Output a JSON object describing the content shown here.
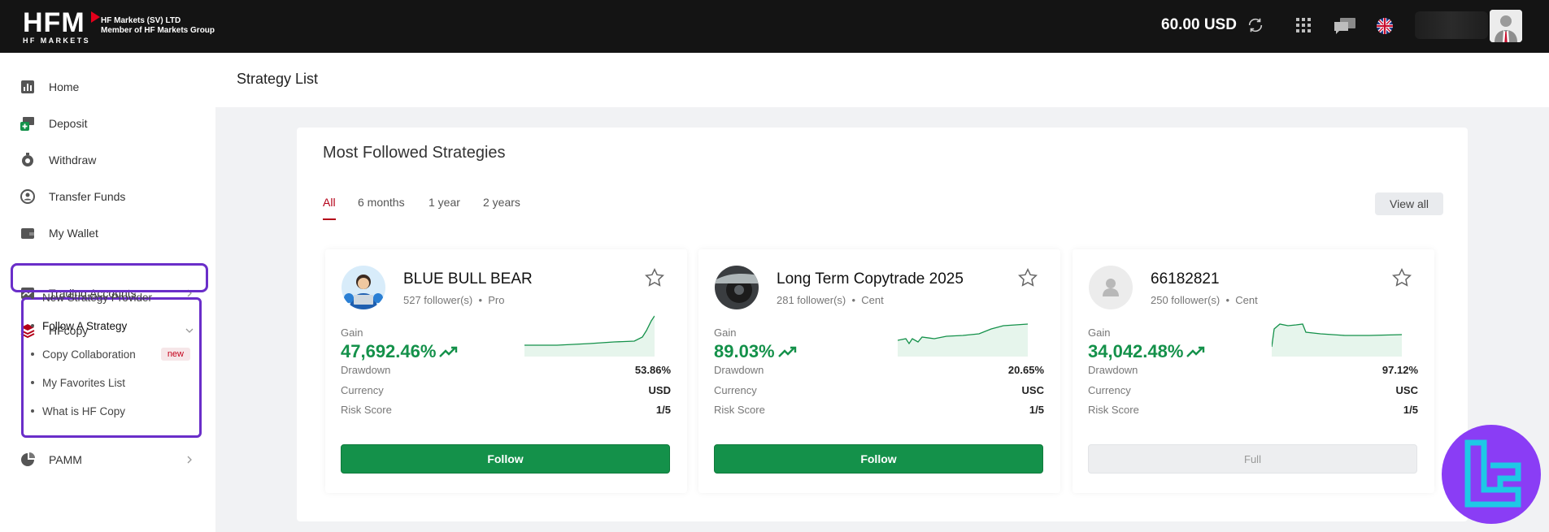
{
  "topbar": {
    "logo_big": "HFM",
    "logo_small": "HF MARKETS",
    "company_line1": "HF Markets (SV) LTD",
    "company_line2": "Member of HF Markets Group",
    "balance": "60.00 USD"
  },
  "sidebar": {
    "items": [
      {
        "label": "Home",
        "icon": "chart-icon"
      },
      {
        "label": "Deposit",
        "icon": "deposit-icon"
      },
      {
        "label": "Withdraw",
        "icon": "withdraw-icon"
      },
      {
        "label": "Transfer Funds",
        "icon": "transfer-icon"
      },
      {
        "label": "My Wallet",
        "icon": "wallet-icon"
      },
      {
        "label": "Trading Accounts",
        "icon": "trading-icon"
      },
      {
        "label": "HFcopy",
        "icon": "layers-icon"
      },
      {
        "label": "PAMM",
        "icon": "pie-icon"
      }
    ],
    "hfcopy_sub": [
      {
        "label": "New Strategy Provider"
      },
      {
        "label": "Follow A Strategy"
      },
      {
        "label": "Copy Collaboration",
        "badge": "new"
      },
      {
        "label": "My Favorites List"
      },
      {
        "label": "What is HF Copy"
      }
    ]
  },
  "header": {
    "title": "Strategy List"
  },
  "panel": {
    "title": "Most Followed Strategies",
    "tabs": [
      "All",
      "6 months",
      "1 year",
      "2 years"
    ],
    "view_all": "View all",
    "labels": {
      "gain": "Gain",
      "drawdown": "Drawdown",
      "currency": "Currency",
      "risk": "Risk Score"
    },
    "cards": [
      {
        "name": "BLUE BULL BEAR",
        "followers": "527 follower(s)",
        "type": "Pro",
        "gain": "47,692.46%",
        "drawdown": "53.86%",
        "currency": "USD",
        "risk": "1/5",
        "button": "Follow"
      },
      {
        "name": "Long Term Copytrade 2025",
        "followers": "281 follower(s)",
        "type": "Cent",
        "gain": "89.03%",
        "drawdown": "20.65%",
        "currency": "USC",
        "risk": "1/5",
        "button": "Follow"
      },
      {
        "name": "66182821",
        "followers": "250 follower(s)",
        "type": "Cent",
        "gain": "34,042.48%",
        "drawdown": "97.12%",
        "currency": "USC",
        "risk": "1/5",
        "button": "Full"
      }
    ]
  },
  "colors": {
    "accent_red": "#b40018",
    "green": "#14914a",
    "purple": "#6a2ec9",
    "topbar": "#141414"
  }
}
